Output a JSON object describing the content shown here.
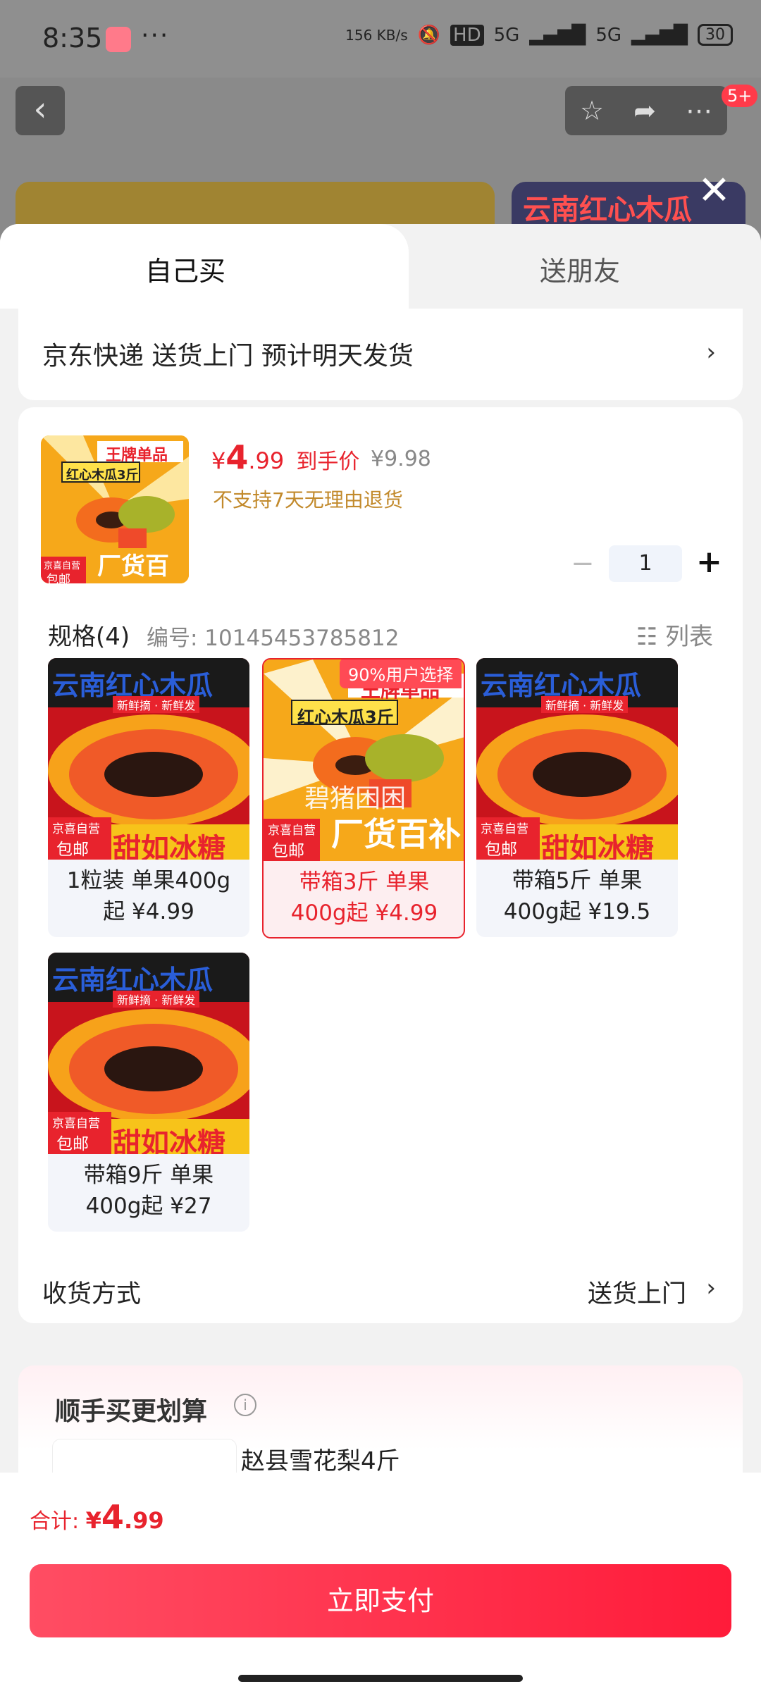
{
  "status_bar": {
    "time": "8:35",
    "net_speed": "156 KB/s",
    "hd": "HD",
    "signal1": "5G",
    "signal2": "5G",
    "battery": "30"
  },
  "nav": {
    "back_icon": "‹",
    "badge": "5+"
  },
  "background": {
    "banner_right_text": "云南红心木瓜"
  },
  "tabs": {
    "buy_self": "自己买",
    "send_friend": "送朋友"
  },
  "delivery": {
    "text": "京东快递 送货上门 预计明天发货"
  },
  "product": {
    "price_symbol": "¥",
    "price_int": "4",
    "price_dec": ".99",
    "price_note": "到手价",
    "original_price": "¥9.98",
    "return_policy": "不支持7天无理由退货",
    "quantity": "1",
    "thumb_text1": "王牌单品",
    "thumb_text2": "红心木瓜3斤",
    "thumb_text3": "厂货百补",
    "thumb_tag1": "京喜自营",
    "thumb_tag2": "包邮"
  },
  "spec": {
    "title": "规格(4)",
    "code": "编号: 10145453785812",
    "list_label": "列表"
  },
  "variants": [
    {
      "line1": "1粒装 单果400g",
      "line2": "起 ¥4.99",
      "banner": "云南红心木瓜",
      "sub": "新鲜摘 · 新鲜发",
      "bottom": "甜如冰糖",
      "tag1": "京喜自营",
      "tag2": "包邮"
    },
    {
      "line1": "带箱3斤 单果",
      "line2": "400g起 ¥4.99",
      "tag": "90%用户选择",
      "banner": "王牌单品",
      "sub": "红心木瓜3斤",
      "bottom": "厂货百补",
      "watermark": "碧猪困困",
      "tag1": "京喜自营",
      "tag2": "包邮"
    },
    {
      "line1": "带箱5斤 单果",
      "line2": "400g起 ¥19.5",
      "banner": "云南红心木瓜",
      "sub": "新鲜摘 · 新鲜发",
      "bottom": "甜如冰糖",
      "tag1": "京喜自营",
      "tag2": "包邮"
    },
    {
      "line1": "带箱9斤 单果",
      "line2": "400g起 ¥27",
      "banner": "云南红心木瓜",
      "sub": "新鲜摘 · 新鲜发",
      "bottom": "甜如冰糖",
      "tag1": "京喜自营",
      "tag2": "包邮"
    }
  ],
  "receive": {
    "label": "收货方式",
    "value": "送货上门"
  },
  "extra": {
    "title": "顺手买更划算",
    "item_name": "赵县雪花梨4斤"
  },
  "bottom": {
    "total_label": "合计: ",
    "total_symbol": "¥",
    "total_int": "4",
    "total_dec": ".99",
    "pay_button": "立即支付"
  },
  "colors": {
    "accent": "#e8232d",
    "pay_gradient_start": "#ff4d63",
    "pay_gradient_end": "#ff1b3a"
  },
  "icons": {
    "back": "chevron-left-icon",
    "star": "star-icon",
    "share": "share-icon",
    "more": "more-icon",
    "close": "close-icon",
    "minus": "minus-icon",
    "plus": "plus-icon",
    "list": "list-icon",
    "info": "info-icon",
    "chevron": "chevron-right-icon"
  }
}
